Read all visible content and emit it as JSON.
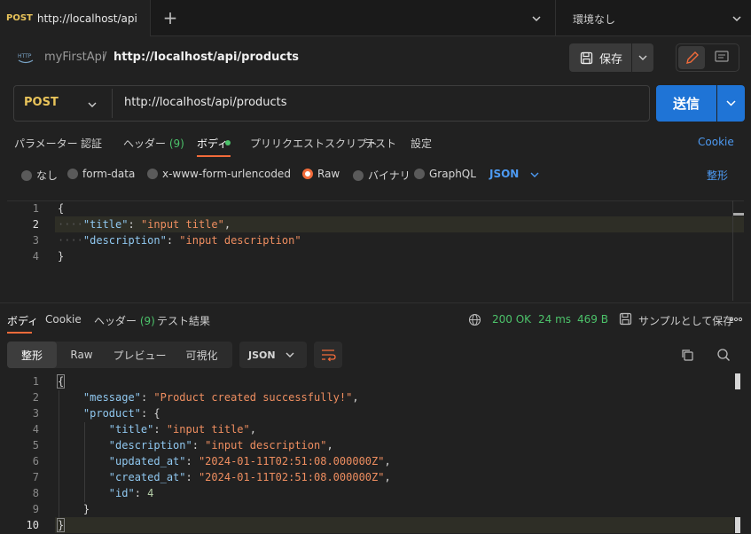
{
  "tab": {
    "method": "POST",
    "url": "http://localhost/api/p・",
    "close": "×"
  },
  "new_tab": "+",
  "environment": "環境なし",
  "breadcrumb": {
    "icon_text": "HTTP",
    "collection": "myFirstApi",
    "separator": "/",
    "request": "http://localhost/api/products"
  },
  "save_label": "保存",
  "request": {
    "method": "POST",
    "url": "http://localhost/api/products",
    "send_label": "送信"
  },
  "req_tabs": [
    {
      "label": "パラメーター"
    },
    {
      "label": "認証"
    },
    {
      "label": "ヘッダー",
      "count": "(9)"
    },
    {
      "label": "ボディ"
    },
    {
      "label": "プリリクエストスクリプト"
    },
    {
      "label": "テスト"
    },
    {
      "label": "設定"
    }
  ],
  "cookie_link": "Cookie",
  "body_modes": [
    "なし",
    "form-data",
    "x-www-form-urlencoded",
    "Raw",
    "バイナリ",
    "GraphQL"
  ],
  "body_lang": "JSON",
  "beautify": "整形",
  "req_body": {
    "line_numbers": [
      "1",
      "2",
      "3",
      "4"
    ],
    "open": "{",
    "close": "}",
    "k_title": "\"title\"",
    "v_title": "\"input title\"",
    "k_desc": "\"description\"",
    "v_desc": "\"input description\""
  },
  "resp_tabs": [
    {
      "label": "ボディ"
    },
    {
      "label": "Cookie"
    },
    {
      "label": "ヘッダー",
      "count": "(9)"
    },
    {
      "label": "テスト結果"
    }
  ],
  "response_meta": {
    "status": "200 OK",
    "time": "24 ms",
    "size": "469 B",
    "save_example": "サンプルとして保存"
  },
  "view_modes": [
    "整形",
    "Raw",
    "プレビュー",
    "可視化"
  ],
  "resp_lang": "JSON",
  "resp_body": {
    "line_numbers": [
      "1",
      "2",
      "3",
      "4",
      "5",
      "6",
      "7",
      "8",
      "9",
      "10"
    ],
    "open": "{",
    "close": "}",
    "k_message": "\"message\"",
    "v_message": "\"Product created successfully!\"",
    "k_product": "\"product\"",
    "k_title": "\"title\"",
    "v_title": "\"input title\"",
    "k_desc": "\"description\"",
    "v_desc": "\"input description\"",
    "k_updated": "\"updated_at\"",
    "v_updated": "\"2024-01-11T02:51:08.000000Z\"",
    "k_created": "\"created_at\"",
    "v_created": "\"2024-01-11T02:51:08.000000Z\"",
    "k_id": "\"id\"",
    "v_id": "4",
    "inner_close": "}"
  },
  "colors": {
    "accent": "#f26b3a",
    "primary": "#1f74d6",
    "success": "#4cc26a",
    "method": "#e8c35a",
    "link": "#4d9af2"
  }
}
